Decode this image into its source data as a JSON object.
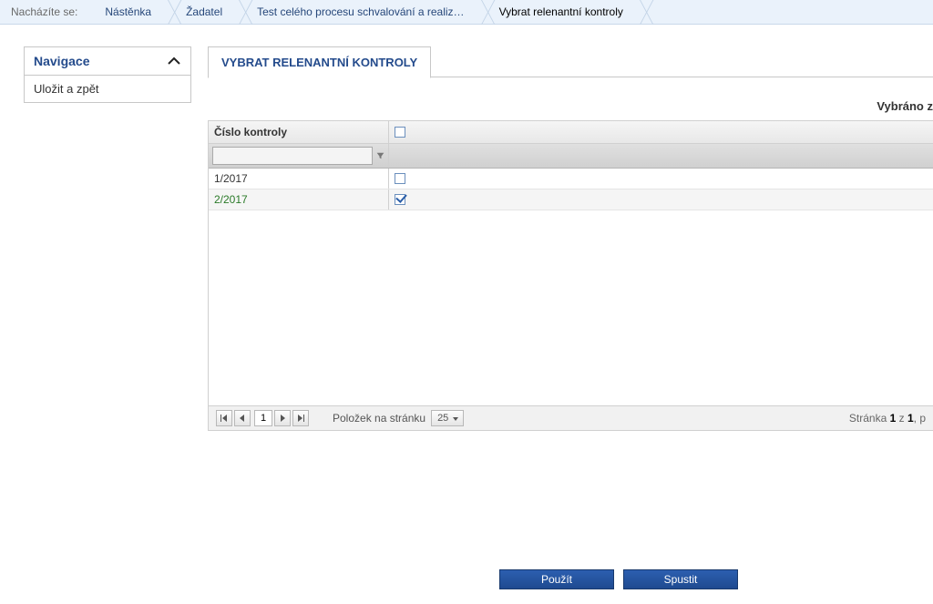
{
  "breadcrumb": {
    "label": "Nacházíte se:",
    "items": [
      {
        "label": "Nástěnka"
      },
      {
        "label": "Žadatel"
      },
      {
        "label": "Test celého procesu schvalování a realiz…"
      },
      {
        "label": "Vybrat relenantní kontroly"
      }
    ]
  },
  "nav": {
    "title": "Navigace",
    "items": [
      {
        "label": "Uložit a zpět"
      }
    ]
  },
  "tab": {
    "title": "VYBRAT RELENANTNÍ KONTROLY"
  },
  "selected_info": "Vybráno z",
  "grid": {
    "columns": {
      "number": "Číslo kontroly"
    },
    "rows": [
      {
        "number": "1/2017",
        "checked": false
      },
      {
        "number": "2/2017",
        "checked": true
      }
    ]
  },
  "pager": {
    "page": "1",
    "items_label": "Položek na stránku",
    "page_size": "25",
    "info_prefix": "Stránka ",
    "info_page": "1",
    "info_mid": " z ",
    "info_total": "1",
    "info_suffix": ", p"
  },
  "actions": {
    "use": "Použít",
    "run": "Spustit"
  }
}
